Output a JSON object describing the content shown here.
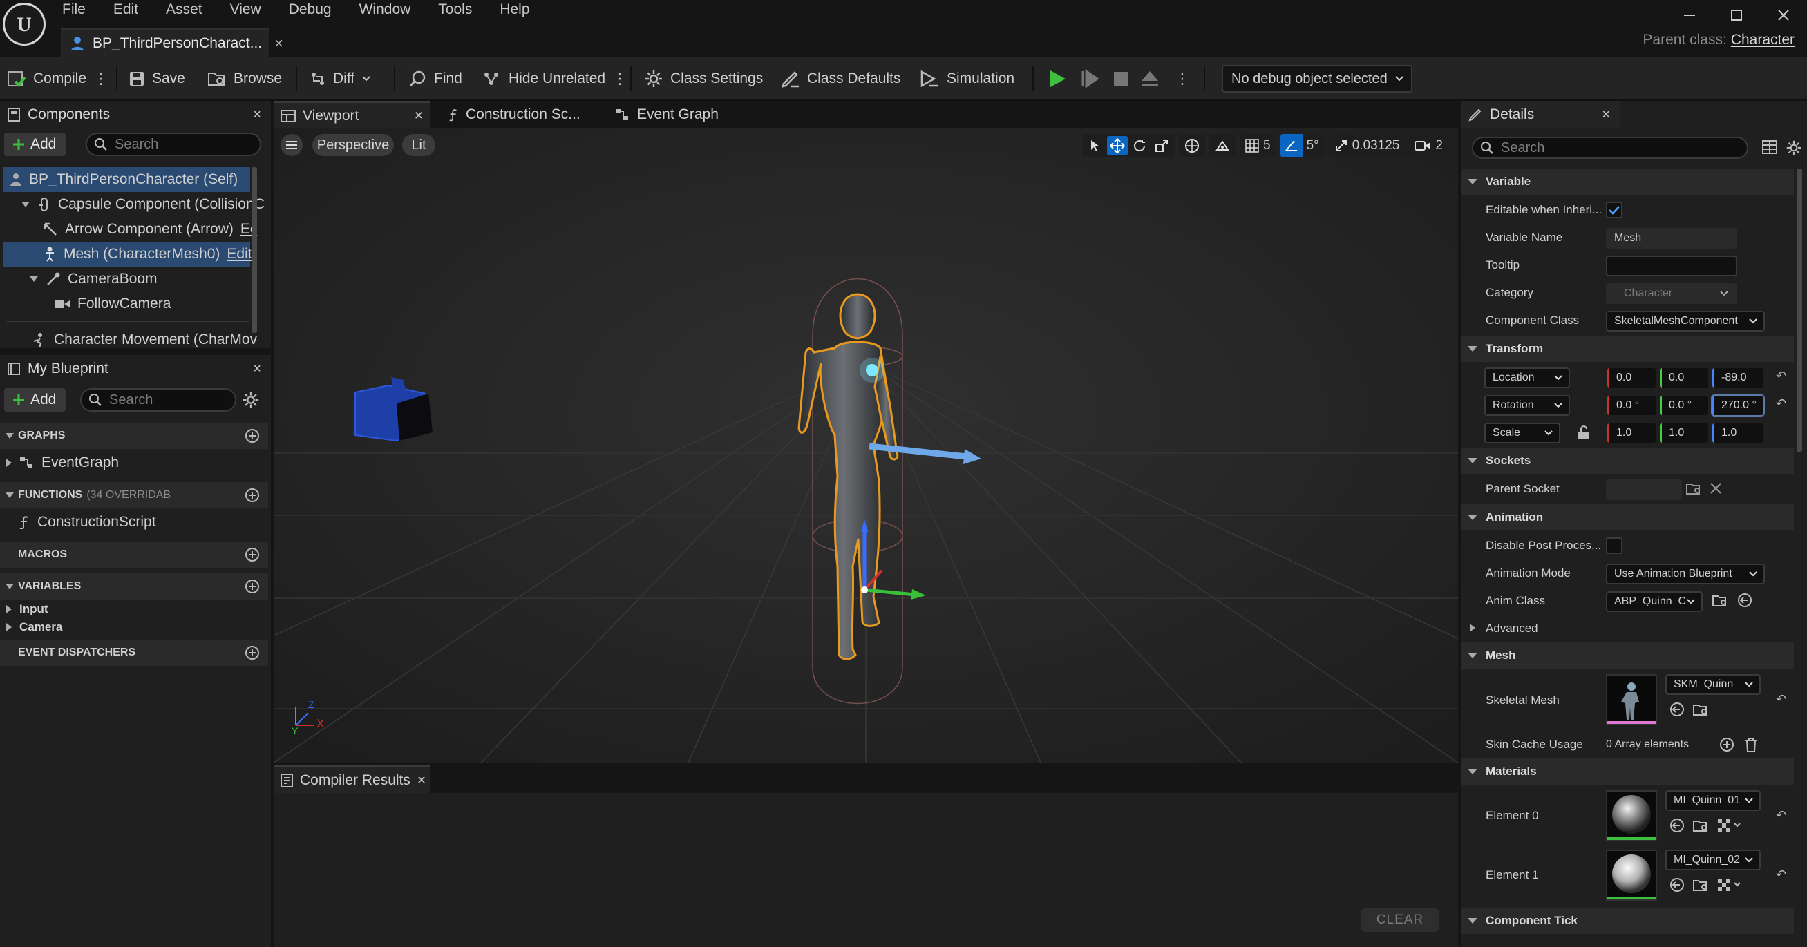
{
  "menu": [
    "File",
    "Edit",
    "Asset",
    "View",
    "Debug",
    "Window",
    "Tools",
    "Help"
  ],
  "document_tab": {
    "title": "BP_ThirdPersonCharact...",
    "close": "×"
  },
  "parent_class": {
    "label": "Parent class:",
    "value": "Character"
  },
  "toolbar": {
    "compile": "Compile",
    "save": "Save",
    "browse": "Browse",
    "diff": "Diff",
    "find": "Find",
    "hide_unrelated": "Hide Unrelated",
    "class_settings": "Class Settings",
    "class_defaults": "Class Defaults",
    "simulation": "Simulation",
    "debug_object": "No debug object selected"
  },
  "components": {
    "tab": "Components",
    "add": "Add",
    "search_placeholder": "Search",
    "tree": [
      {
        "label": "BP_ThirdPersonCharacter (Self)"
      },
      {
        "label": "Capsule Component (CollisionC"
      },
      {
        "label": "Arrow Component (Arrow)",
        "suffix": "Ec"
      },
      {
        "label": "Mesh (CharacterMesh0)",
        "suffix": "Edit"
      },
      {
        "label": "CameraBoom"
      },
      {
        "label": "FollowCamera"
      },
      {
        "label": "Character Movement (CharMov"
      }
    ]
  },
  "my_blueprint": {
    "tab": "My Blueprint",
    "add": "Add",
    "search_placeholder": "Search",
    "graphs": "GRAPHS",
    "event_graph": "EventGraph",
    "functions": "FUNCTIONS",
    "functions_note": "(34 OVERRIDAB",
    "construction_script": "ConstructionScript",
    "macros": "MACROS",
    "variables": "VARIABLES",
    "var_input": "Input",
    "var_camera": "Camera",
    "event_dispatchers": "EVENT DISPATCHERS"
  },
  "editor_tabs": {
    "viewport": "Viewport",
    "construction": "Construction Sc...",
    "event_graph": "Event Graph"
  },
  "viewport": {
    "perspective": "Perspective",
    "lit": "Lit",
    "grid_size": "5",
    "rot_snap": "5°",
    "scale_snap": "0.03125",
    "camera_speed": "2",
    "axis_x": "X",
    "axis_y": "Y",
    "axis_z": "Z"
  },
  "compiler": {
    "tab": "Compiler Results",
    "clear": "CLEAR"
  },
  "details": {
    "tab": "Details",
    "search_placeholder": "Search",
    "sec_variable": "Variable",
    "editable_label": "Editable when Inheri...",
    "editable_checked": true,
    "varname_label": "Variable Name",
    "varname_value": "Mesh",
    "tooltip_label": "Tooltip",
    "tooltip_value": "",
    "category_label": "Category",
    "category_value": "Character",
    "compclass_label": "Component Class",
    "compclass_value": "SkeletalMeshComponent",
    "sec_transform": "Transform",
    "location": "Location",
    "location_values": [
      "0.0",
      "0.0",
      "-89.0"
    ],
    "rotation": "Rotation",
    "rotation_values": [
      "0.0 °",
      "0.0 °",
      "270.0 °"
    ],
    "scale": "Scale",
    "scale_values": [
      "1.0",
      "1.0",
      "1.0"
    ],
    "sec_sockets": "Sockets",
    "parent_socket_label": "Parent Socket",
    "sec_animation": "Animation",
    "disable_post_label": "Disable Post Proces...",
    "anim_mode_label": "Animation Mode",
    "anim_mode_value": "Use Animation Blueprint",
    "anim_class_label": "Anim Class",
    "anim_class_value": "ABP_Quinn_C",
    "sec_advanced": "Advanced",
    "sec_mesh": "Mesh",
    "skeletal_mesh_label": "Skeletal Mesh",
    "skeletal_mesh_value": "SKM_Quinn_",
    "skin_cache_label": "Skin Cache Usage",
    "skin_cache_value": "0 Array elements",
    "sec_materials": "Materials",
    "element0_label": "Element 0",
    "element0_value": "MI_Quinn_01",
    "element1_label": "Element 1",
    "element1_value": "MI_Quinn_02",
    "sec_component_tick": "Component Tick"
  },
  "colors": {
    "accent": "#0b66c2",
    "play": "#3fbf3f",
    "selection": "#2b4a72"
  }
}
